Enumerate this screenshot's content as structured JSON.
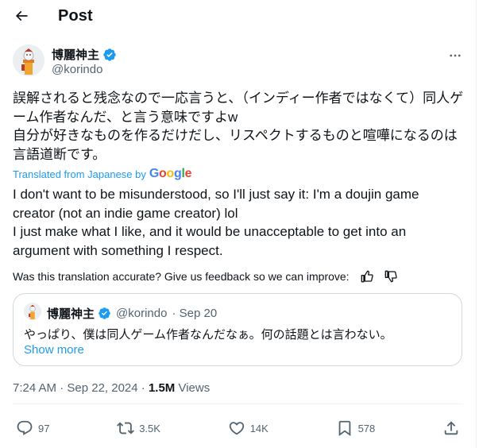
{
  "header": {
    "title": "Post"
  },
  "author": {
    "display_name": "博麗神主",
    "handle": "@korindo",
    "verified_badge": "verified-badge-icon"
  },
  "post": {
    "text_jp": "誤解されると残念なので一応言うと、（インディー作者ではなくて）同人ゲーム作者なんだ、と言う意味ですよw\n自分が好きなものを作るだけだし、リスペクトするものと喧嘩になるのは言語道断です。",
    "translated_label": "Translated from Japanese by",
    "translator": "Google",
    "text_en": "I don't want to be misunderstood, so I'll just say it: I'm a doujin game creator (not an indie game creator) lol\nI just make what I like, and it would be unacceptable to get into an argument with something I respect.",
    "feedback_question": "Was this translation accurate? Give us feedback so we can improve:"
  },
  "quote": {
    "display_name": "博麗神主",
    "handle": "@korindo",
    "date": "· Sep 20",
    "text": "やっぱり、僕は同人ゲーム作者なんだなぁ。何の話題とは言わない。",
    "show_more": "Show more"
  },
  "meta": {
    "time_date": "7:24 AM · Sep 22, 2024 · ",
    "views_count": "1.5M",
    "views_label": " Views"
  },
  "actions": {
    "replies": "97",
    "reposts": "3.5K",
    "likes": "14K",
    "bookmarks": "578"
  },
  "colors": {
    "accent": "#1d9bf0",
    "secondary_text": "#536471",
    "border": "#cfd9de"
  }
}
